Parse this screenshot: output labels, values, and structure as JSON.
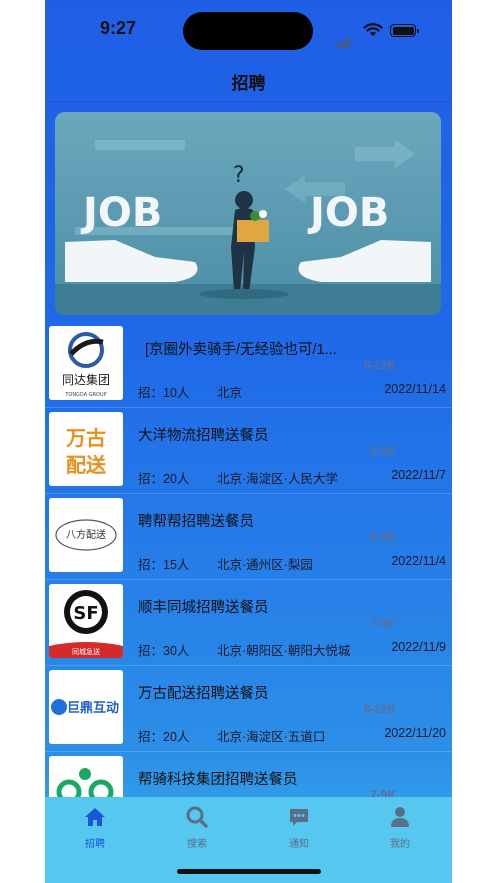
{
  "status_bar": {
    "time": "9:27"
  },
  "navbar": {
    "title": "招聘"
  },
  "banner": {
    "left_text": "JOB",
    "right_text": "JOB",
    "question": "?"
  },
  "jobs": [
    {
      "title": "[京圈外卖骑手/无经验也可/1...",
      "salary": "8-12K",
      "count": "招：10人",
      "location": "北京",
      "date": "2022/11/14",
      "logo": "同达集团",
      "logo_sub": "TONGDA GROUP"
    },
    {
      "title": "大洋物流招聘送餐员",
      "salary": "8-9K",
      "count": "招：20人",
      "location": "北京·海淀区·人民大学",
      "date": "2022/11/7",
      "logo": "万古配送"
    },
    {
      "title": "聘帮帮招聘送餐员",
      "salary": "8-9K",
      "count": "招：15人",
      "location": "北京·通州区·梨园",
      "date": "2022/11/4",
      "logo": "八方配送"
    },
    {
      "title": "顺丰同城招聘送餐员",
      "salary": "7-8K",
      "count": "招：30人",
      "location": "北京·朝阳区·朝阳大悦城",
      "date": "2022/11/9",
      "logo": "同城急送"
    },
    {
      "title": "万古配送招聘送餐员",
      "salary": "8-12K",
      "count": "招：20人",
      "location": "北京·海淀区·五道口",
      "date": "2022/11/20",
      "logo": "巨鼎互动"
    },
    {
      "title": "帮骑科技集团招聘送餐员",
      "salary": "7-9K",
      "count": "",
      "location": "",
      "date": "",
      "logo": ""
    }
  ],
  "tabbar": {
    "items": [
      {
        "label": "招聘",
        "icon": "home-icon",
        "active": true
      },
      {
        "label": "搜索",
        "icon": "search-icon",
        "active": false
      },
      {
        "label": "通知",
        "icon": "message-icon",
        "active": false
      },
      {
        "label": "我的",
        "icon": "person-icon",
        "active": false
      }
    ]
  },
  "colors": {
    "accent": "#1a56d6",
    "tabbar_bg": "#56c8ef",
    "bg_top": "#1f5fe6"
  }
}
